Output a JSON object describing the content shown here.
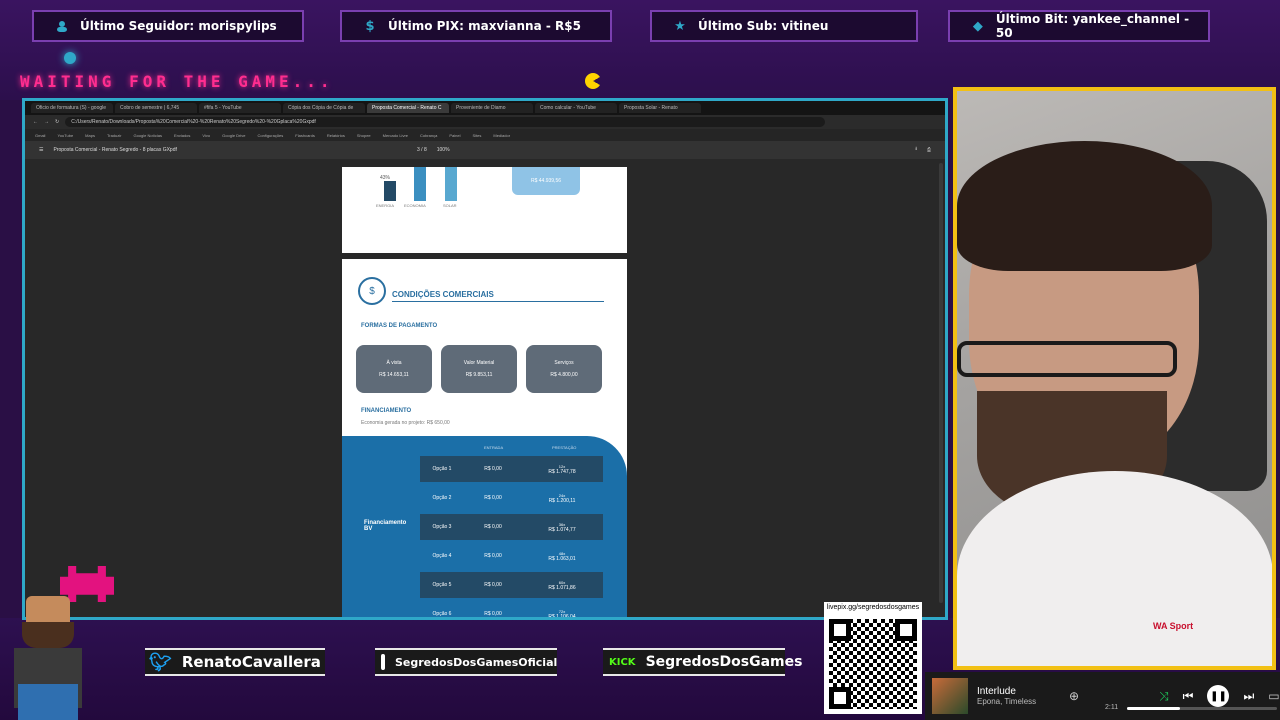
{
  "alerts": [
    {
      "icon": "person-icon",
      "text": "Último Seguidor: morispylips"
    },
    {
      "icon": "dollar-icon",
      "text": "Último PIX: maxvianna - R$5"
    },
    {
      "icon": "star-icon",
      "text": "Último Sub: vitineu"
    },
    {
      "icon": "diamond-icon",
      "text": "Último Bit: yankee_channel - 50"
    }
  ],
  "waiting_text": "WAITING FOR THE GAME...",
  "browser": {
    "tabs": [
      "Oficio de formatura (S) - google",
      "Cobro de semestre | 6,745",
      "#fifa 5 - YouTube",
      "Cópia dos Cópia de Cópia de",
      "Proposta Comercial - Renato C",
      "Proveniente de Diamo",
      "Como calcular - YouTube",
      "Proposta Solar - Renato"
    ],
    "url": "C:/Users/Renato/Downloads/Proposta%20Comercial%20-%20Renato%20Segredo%20-%20Gplaca%20Gxpdf",
    "bookmarks": [
      "Gmail",
      "YouTube",
      "Maps",
      "Traduzir",
      "Google Notícias",
      "Enviados",
      "Vivo",
      "Google Drive",
      "Configurações",
      "Flashcards",
      "Relatórios",
      "Shopee",
      "Mercado Livre",
      "Cobrança",
      "Painel",
      "Sites",
      "Mediador"
    ],
    "pdf_title": "Proposta Comercial - Renato Segredo - 8 placas GXpdf",
    "page_indicator": "3 / 8",
    "zoom": "100%"
  },
  "pdf": {
    "chart_bars": [
      {
        "label": "ENERGIA",
        "pct": "43%"
      },
      {
        "label": "ECONOMIA",
        "pct": ""
      },
      {
        "label": "SOLAR",
        "pct": ""
      }
    ],
    "blue_value": "R$ 44.939,56",
    "section_title": "CONDIÇÕES COMERCIAIS",
    "payment_heading": "FORMAS DE PAGAMENTO",
    "payment_options": [
      {
        "label": "À vista",
        "value": "R$ 14.653,11"
      },
      {
        "label": "Valor Material",
        "value": "R$ 9.853,11"
      },
      {
        "label": "Serviços",
        "value": "R$ 4.800,00"
      }
    ],
    "financing_heading": "FINANCIAMENTO",
    "financing_note": "Economia gerada no projeto: R$ 650,00",
    "financing_label": "Financiamento BV",
    "col_entrada": "ENTRADA",
    "col_prestacao": "PRESTAÇÃO",
    "options": [
      {
        "name": "Opção 1",
        "entrada": "R$ 0,00",
        "parcelas": "12x",
        "valor": "R$ 1.747,78"
      },
      {
        "name": "Opção 2",
        "entrada": "R$ 0,00",
        "parcelas": "24x",
        "valor": "R$ 1.200,11"
      },
      {
        "name": "Opção 3",
        "entrada": "R$ 0,00",
        "parcelas": "36x",
        "valor": "R$ 1.074,77"
      },
      {
        "name": "Opção 4",
        "entrada": "R$ 0,00",
        "parcelas": "48x",
        "valor": "R$ 1.063,01"
      },
      {
        "name": "Opção 5",
        "entrada": "R$ 0,00",
        "parcelas": "60x",
        "valor": "R$ 1.071,86"
      },
      {
        "name": "Opção 6",
        "entrada": "R$ 0,00",
        "parcelas": "72x",
        "valor": "R$ 1.106,04"
      }
    ]
  },
  "socials": [
    {
      "icon": "twitter-icon",
      "handle": "RenatoCavallera"
    },
    {
      "icon": "instagram-icon",
      "handle": "SegredosDosGamesOficial"
    },
    {
      "icon": "kick-icon",
      "handle": "SegredosDosGames",
      "badge": "KICK"
    }
  ],
  "qr": {
    "caption": "livepix.gg/segredosdosgames"
  },
  "music": {
    "title": "Interlude",
    "artist": "Epona, Timeless",
    "time": "2:11",
    "progress": 0.35
  },
  "webcam": {
    "shirt_text": "WA Sport"
  },
  "colors": {
    "accent": "#2fa8c8",
    "frame": "#f2c014",
    "pink": "#ff2d8f",
    "bg": "#2a0f45"
  }
}
